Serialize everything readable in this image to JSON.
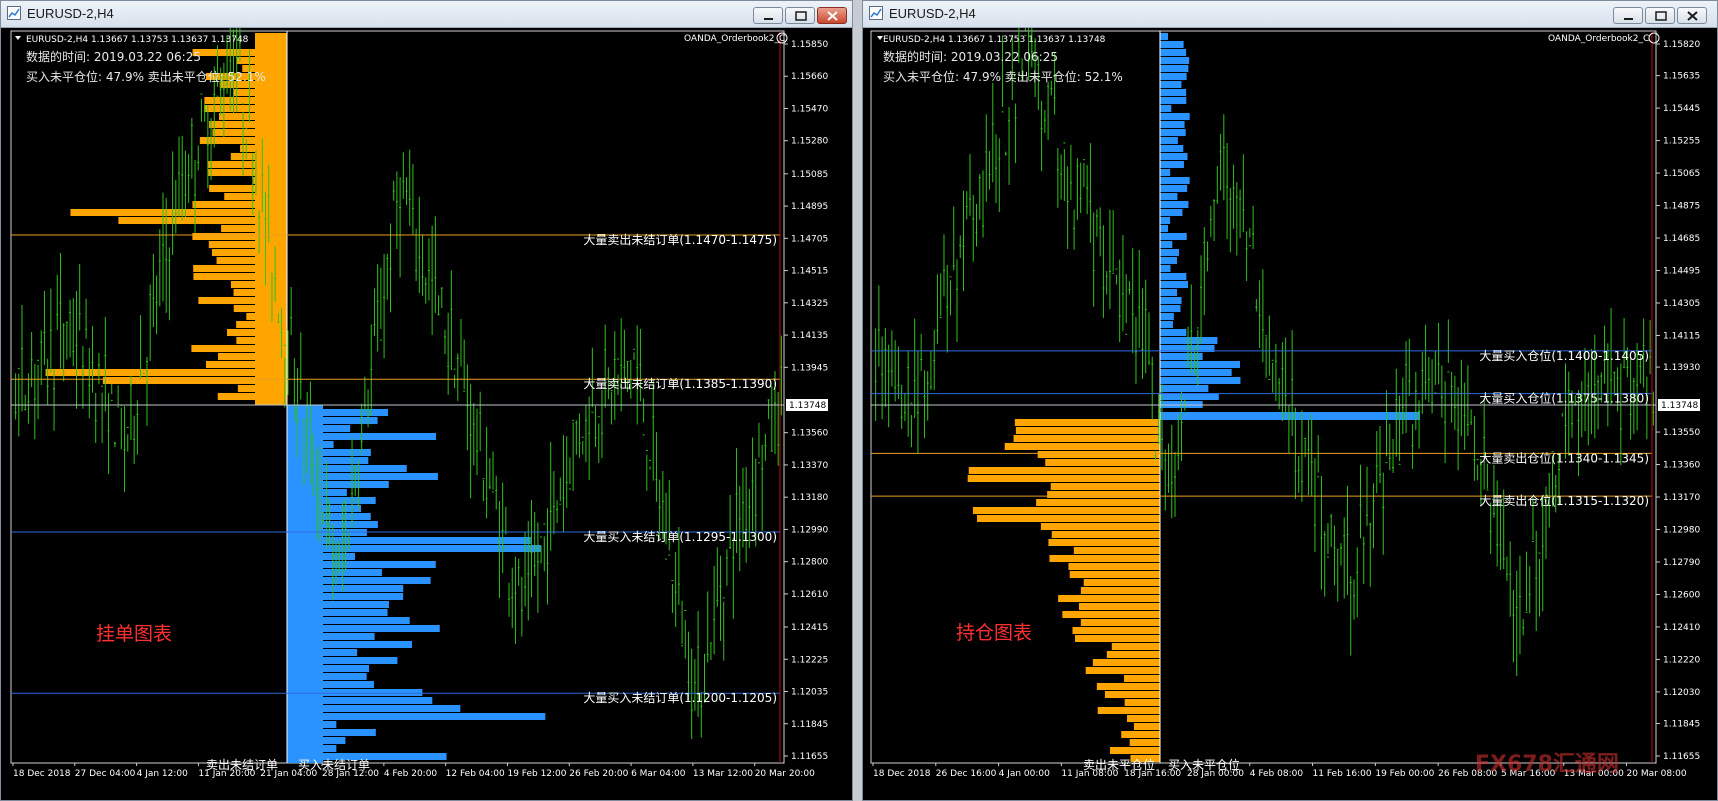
{
  "colors": {
    "candles": "#2fc21a",
    "sell_bars": "#ffa500",
    "buy_bars": "#2a93ff",
    "sell_line": "#e8a020",
    "buy_line": "#2d6be0",
    "price_line": "#c0c8d0",
    "red_line": "#c01010",
    "note": "#ff3030",
    "background": "#000000"
  },
  "windows": [
    {
      "id": "left",
      "title": "EURUSD-2,H4",
      "header": {
        "symbol_info": "EURUSD-2,H4  1.13667 1.13753 1.13637 1.13748",
        "data_time": "数据的时间: 2019.03.22 06:25",
        "ratio": "买入未平仓位: 47.9%  卖出未平仓位: 52.1%",
        "indicator": "OANDA_Orderbook2_C"
      },
      "note": "挂单图表",
      "upper_bar_label": "卖出未结订单",
      "lower_bar_label": "买入未结订单",
      "price_ticks": [
        "1.15850",
        "1.15660",
        "1.15470",
        "1.15280",
        "1.15085",
        "1.14895",
        "1.14705",
        "1.14515",
        "1.14325",
        "1.14135",
        "1.13945",
        "1.13560",
        "1.13370",
        "1.13180",
        "1.12990",
        "1.12800",
        "1.12610",
        "1.12415",
        "1.12225",
        "1.12035",
        "1.11845",
        "1.11655"
      ],
      "current_price": "1.13748",
      "time_labels": [
        "18 Dec 2018",
        "27 Dec 04:00",
        "4 Jan 12:00",
        "11 Jan 20:00",
        "21 Jan 04:00",
        "28 Jan 12:00",
        "4 Feb 20:00",
        "12 Feb 04:00",
        "19 Feb 12:00",
        "26 Feb 20:00",
        "6 Mar 04:00",
        "13 Mar 12:00",
        "20 Mar 20:00"
      ],
      "levels": [
        {
          "text": "大量卖出未结订单(1.1470-1.1475)",
          "price": 1.14725,
          "kind": "sell"
        },
        {
          "text": "大量卖出未结订单(1.1385-1.1390)",
          "price": 1.13875,
          "kind": "sell"
        },
        {
          "text": "大量买入未结订单(1.1295-1.1300)",
          "price": 1.12975,
          "kind": "buy"
        },
        {
          "text": "大量买入未结订单(1.1200-1.1205)",
          "price": 1.12025,
          "kind": "buy"
        }
      ]
    },
    {
      "id": "right",
      "title": "EURUSD-2,H4",
      "header": {
        "symbol_info": "EURUSD-2,H4  1.13667 1.13753 1.13637 1.13748",
        "data_time": "数据的时间: 2019.03.22 06:25",
        "ratio": "买入未平仓位: 47.9%  卖出未平仓位: 52.1%",
        "indicator": "OANDA_Orderbook2_C"
      },
      "note": "持仓图表",
      "upper_bar_label": "卖出未平仓位",
      "lower_bar_label": "买入未平仓位",
      "price_ticks": [
        "1.15820",
        "1.15635",
        "1.15445",
        "1.15255",
        "1.15065",
        "1.14875",
        "1.14685",
        "1.14495",
        "1.14305",
        "1.14115",
        "1.13930",
        "1.13550",
        "1.13360",
        "1.13170",
        "1.12980",
        "1.12790",
        "1.12600",
        "1.12410",
        "1.12220",
        "1.12030",
        "1.11845",
        "1.11655"
      ],
      "current_price": "1.13748",
      "time_labels": [
        "18 Dec 2018",
        "26 Dec 16:00",
        "4 Jan 00:00",
        "11 Jan 08:00",
        "18 Jan 16:00",
        "28 Jan 00:00",
        "4 Feb 08:00",
        "11 Feb 16:00",
        "19 Feb 00:00",
        "26 Feb 08:00",
        "5 Mar 16:00",
        "13 Mar 00:00",
        "20 Mar 08:00"
      ],
      "levels": [
        {
          "text": "大量买入仓位(1.1400-1.1405)",
          "price": 1.14025,
          "kind": "buy"
        },
        {
          "text": "大量买入仓位(1.1375-1.1380)",
          "price": 1.13775,
          "kind": "buy"
        },
        {
          "text": "大量卖出仓位(1.1340-1.1345)",
          "price": 1.13425,
          "kind": "sell"
        },
        {
          "text": "大量卖出仓位(1.1315-1.1320)",
          "price": 1.13175,
          "kind": "sell"
        }
      ]
    }
  ],
  "watermark": "FX678汇通网"
}
